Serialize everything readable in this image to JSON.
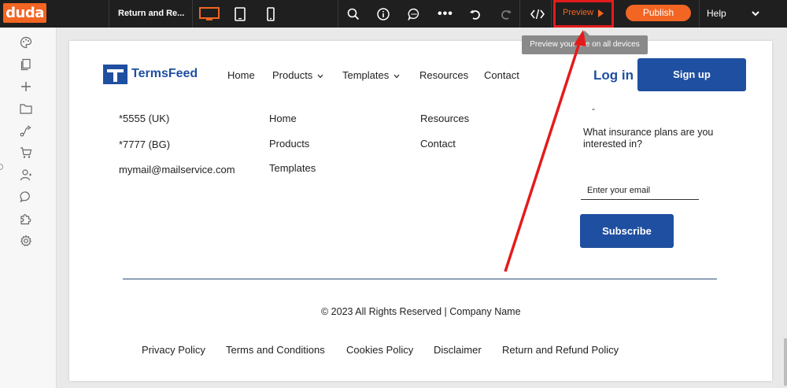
{
  "toolbar": {
    "logo": "duda",
    "page_name": "Return and Re...",
    "preview_label": "Preview",
    "publish_label": "Publish",
    "help_label": "Help",
    "icons": [
      "desktop-icon",
      "tablet-icon",
      "mobile-icon",
      "search-icon",
      "info-icon",
      "comment-icon",
      "more-icon",
      "undo-icon",
      "redo-icon",
      "code-icon"
    ]
  },
  "tooltip": "Preview your site on all devices",
  "sidebar": {
    "icons": [
      "palette-icon",
      "pages-icon",
      "add-icon",
      "folder-icon",
      "flow-icon",
      "cart-icon",
      "user-icon",
      "chat-icon",
      "puzzle-icon",
      "settings-icon"
    ]
  },
  "site": {
    "logo_text": "TermsFeed",
    "nav": {
      "home": "Home",
      "products": "Products",
      "templates": "Templates",
      "resources": "Resources",
      "contact": "Contact"
    },
    "login": "Log in",
    "signup": "Sign up"
  },
  "footer": {
    "contact": [
      "*5555 (UK)",
      "*7777 (BG)",
      "mymail@mailservice.com"
    ],
    "links_col1": [
      "Home",
      "Products",
      "Templates"
    ],
    "links_col2": [
      "Resources",
      "Contact"
    ],
    "question": "What insurance plans are you interested in?",
    "email_placeholder": "Enter your email",
    "subscribe": "Subscribe",
    "copyright": "© 2023 All Rights Reserved | Company Name",
    "policies": [
      "Privacy Policy",
      "Terms and Conditions",
      "Cookies Policy",
      "Disclaimer",
      "Return and Refund Policy"
    ]
  },
  "colors": {
    "brand_orange": "#f26522",
    "site_blue": "#1f4fa0",
    "annotation_red": "#e41b1b"
  }
}
